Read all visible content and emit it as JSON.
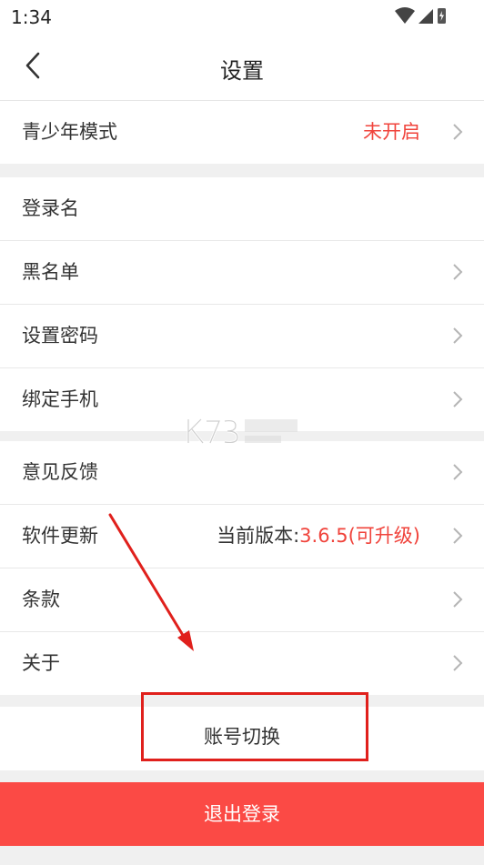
{
  "status_bar": {
    "time": "1:34"
  },
  "header": {
    "title": "设置"
  },
  "groups": [
    {
      "items": [
        {
          "label": "青少年模式",
          "value": "未开启",
          "value_color": "red"
        }
      ]
    },
    {
      "items": [
        {
          "label": "登录名"
        },
        {
          "label": "黑名单"
        },
        {
          "label": "设置密码"
        },
        {
          "label": "绑定手机"
        }
      ]
    },
    {
      "items": [
        {
          "label": "意见反馈"
        },
        {
          "label": "软件更新",
          "value_prefix": "当前版本:",
          "value": "3.6.5(可升级)"
        },
        {
          "label": "条款"
        },
        {
          "label": "关于"
        }
      ]
    }
  ],
  "actions": {
    "switch_account": "账号切换",
    "logout": "退出登录"
  },
  "colors": {
    "accent_red": "#f0433b",
    "logout_bg": "#fb4a45",
    "annotation_red": "#e0201c"
  }
}
